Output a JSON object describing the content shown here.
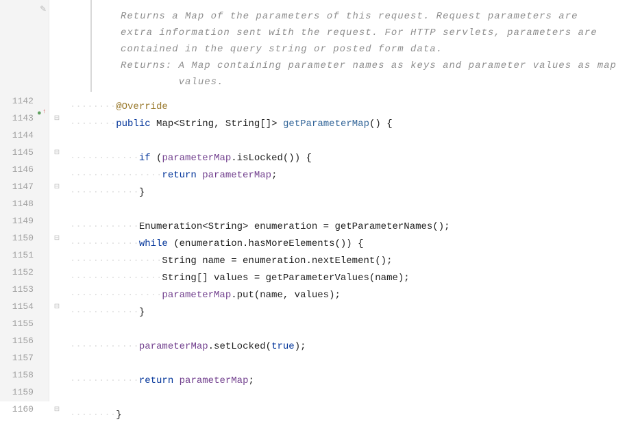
{
  "doc": {
    "desc_line1": "Returns a Map of the parameters of this request. Request parameters are",
    "desc_line2": "extra information sent with the request. For HTTP servlets, parameters are",
    "desc_line3": "contained in the query string or posted form data.",
    "returns_label": "Returns:",
    "returns_line1": "A Map containing parameter names as keys and parameter values as map",
    "returns_line2": "values."
  },
  "lineNumbers": [
    "1142",
    "1143",
    "1144",
    "1145",
    "1146",
    "1147",
    "1148",
    "1149",
    "1150",
    "1151",
    "1152",
    "1153",
    "1154",
    "1155",
    "1156",
    "1157",
    "1158",
    "1159",
    "1160"
  ],
  "code": {
    "l1142": {
      "ws": "········",
      "anno": "@Override"
    },
    "l1143": {
      "ws": "········",
      "kw_public": "public",
      "type_map": "Map",
      "type_str": "String",
      "type_strarr": "String",
      "arr": "[]",
      "method": "getParameterMap",
      "tail": "() {"
    },
    "l1145": {
      "ws": "············",
      "kw_if": "if",
      "open": " (",
      "field": "parameterMap",
      "call": ".isLocked()) {"
    },
    "l1146": {
      "ws": "················",
      "kw_return": "return",
      "sp": " ",
      "field": "parameterMap",
      "semi": ";"
    },
    "l1147": {
      "ws": "············",
      "brace": "}"
    },
    "l1149": {
      "ws": "············",
      "text": "Enumeration<String> enumeration = getParameterNames();"
    },
    "l1150": {
      "ws": "············",
      "kw_while": "while",
      "rest": " (enumeration.hasMoreElements()) {"
    },
    "l1151": {
      "ws": "················",
      "text": "String name = enumeration.nextElement();"
    },
    "l1152": {
      "ws": "················",
      "text": "String[] values = getParameterValues(name);"
    },
    "l1153": {
      "ws": "················",
      "field": "parameterMap",
      "rest": ".put(name, values);"
    },
    "l1154": {
      "ws": "············",
      "brace": "}"
    },
    "l1156": {
      "ws": "············",
      "field": "parameterMap",
      "rest1": ".setLocked(",
      "kw_true": "true",
      "rest2": ");"
    },
    "l1158": {
      "ws": "············",
      "kw_return": "return",
      "sp": " ",
      "field": "parameterMap",
      "semi": ";"
    },
    "l1160": {
      "ws": "········",
      "brace": "}"
    }
  }
}
